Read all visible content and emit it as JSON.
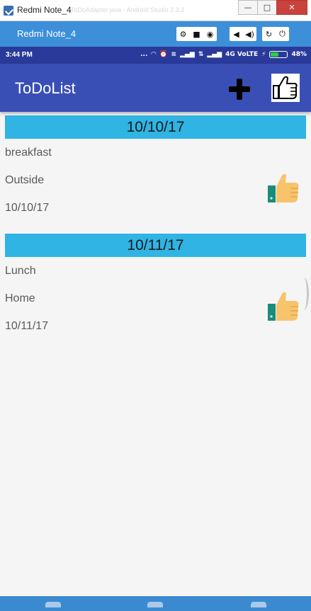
{
  "window": {
    "title": "Redmi Note_4",
    "ghost_text": "ToDoAdapter.java - Android Studio 2.3.3",
    "min_symbol": "—",
    "max_symbol": "□",
    "close_symbol": "✕"
  },
  "emulator": {
    "device_name": "Redmi Note_4",
    "buttons": [
      "⚙",
      "■",
      "◉",
      "◀",
      "◀)",
      "↻",
      "⏻"
    ]
  },
  "status_bar": {
    "time": "3:44 PM",
    "icons": [
      "...",
      "◠",
      "⏰",
      "≋",
      "▂▄▆",
      "⇅",
      "▂▄▆"
    ],
    "network": "4G VoLTE",
    "charging": "⚡",
    "battery_percent": "48%",
    "battery_level": 0.48,
    "battery_color": "#2ecc40"
  },
  "app_bar": {
    "title": "ToDoList",
    "add_icon": "plus-icon",
    "like_icon": "thumbs-up-outline-icon",
    "color": "#3a4fb5"
  },
  "todos": [
    {
      "date_header": "10/10/17",
      "title": "breakfast",
      "place": "Outside",
      "date": "10/10/17",
      "icon": "thumbs-up-icon"
    },
    {
      "date_header": "10/11/17",
      "title": "Lunch",
      "place": "Home",
      "date": "10/11/17",
      "icon": "thumbs-up-icon"
    }
  ],
  "colors": {
    "header": "#2fb4e4",
    "window_bar": "#3d8fd9"
  }
}
